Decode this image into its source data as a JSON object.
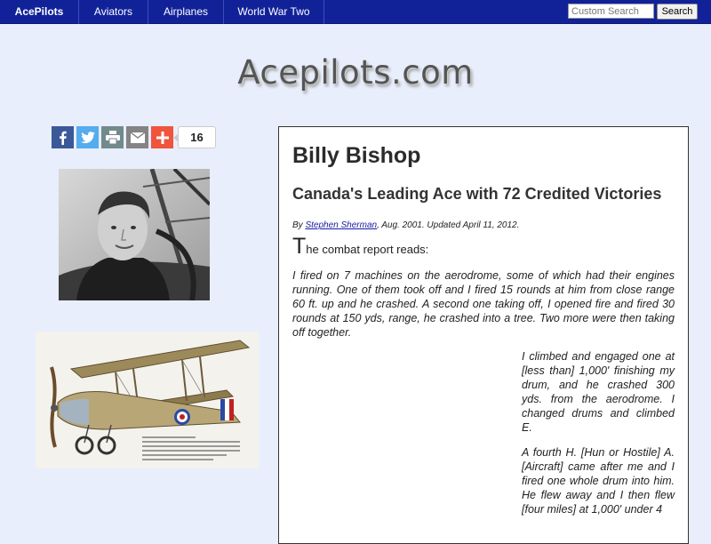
{
  "nav": {
    "brand": "AcePilots",
    "items": [
      "Aviators",
      "Airplanes",
      "World War Two"
    ]
  },
  "search": {
    "placeholder": "Custom Search",
    "button_label": "Search"
  },
  "logo_text": "Acepilots.com",
  "share": {
    "buttons": [
      "facebook-icon",
      "twitter-icon",
      "print-icon",
      "email-icon",
      "plus-icon"
    ],
    "count": "16"
  },
  "colors": {
    "nav_bg": "#112299",
    "page_bg": "#e8eefb",
    "facebook": "#3b5998",
    "twitter": "#55acee",
    "print": "#738a8d",
    "email": "#848484",
    "plus": "#f0543c"
  },
  "article": {
    "title": "Billy Bishop",
    "subtitle": "Canada's Leading Ace with 72 Credited Victories",
    "byline_prefix": "By ",
    "author": "Stephen Sherman",
    "byline_suffix": ", Aug. 2001. Updated April 11, 2012.",
    "lead_first_letter": "T",
    "lead_rest": "he combat report reads:",
    "quote1": "I fired on 7 machines on the aerodrome, some of which had their engines running. One of them took off and I fired 15 rounds at him from close range 60 ft. up and he crashed. A second one taking off, I opened fire and fired 30 rounds at 150 yds, range, he crashed into a tree. Two more were then taking off together.",
    "quote2": "I climbed and engaged one at [less than] 1,000' finishing my drum, and he crashed 300 yds. from the aerodrome. I changed drums and climbed E.",
    "quote3": "A fourth H. [Hun or Hostile] A. [Aircraft] came after me and I fired one whole drum into him. He flew away and I then flew [four miles] at 1,000' under 4"
  }
}
